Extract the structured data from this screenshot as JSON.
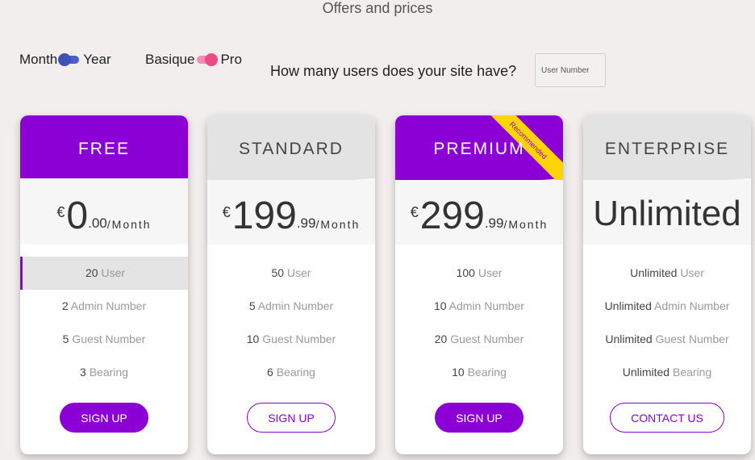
{
  "page_title": "Offers and prices",
  "toggles": {
    "billing_left": "Month",
    "billing_right": "Year",
    "plan_left": "Basique",
    "plan_right": "Pro"
  },
  "users": {
    "question": "How many users does your site have?",
    "placeholder": "User Number"
  },
  "colors": {
    "accent": "#8b00d4",
    "ribbon": "#ffd400",
    "billing_toggle": "#3f51b5",
    "plan_toggle": "#ee4b85"
  },
  "plans": [
    {
      "name": "FREE",
      "currency": "€",
      "price_int": "0",
      "price_dec": ".00",
      "period": "/Month",
      "features": [
        {
          "num": "20",
          "label": "User"
        },
        {
          "num": "2",
          "label": "Admin Number"
        },
        {
          "num": "5",
          "label": "Guest Number"
        },
        {
          "num": "3",
          "label": "Bearing"
        }
      ],
      "button": "SIGN UP"
    },
    {
      "name": "STANDARD",
      "currency": "€",
      "price_int": "199",
      "price_dec": ".99",
      "period": "/Month",
      "features": [
        {
          "num": "50",
          "label": "User"
        },
        {
          "num": "5",
          "label": "Admin Number"
        },
        {
          "num": "10",
          "label": "Guest Number"
        },
        {
          "num": "6",
          "label": "Bearing"
        }
      ],
      "button": "SIGN UP"
    },
    {
      "name": "PREMIUM",
      "ribbon": "Recommended",
      "currency": "€",
      "price_int": "299",
      "price_dec": ".99",
      "period": "/Month",
      "features": [
        {
          "num": "100",
          "label": "User"
        },
        {
          "num": "10",
          "label": "Admin Number"
        },
        {
          "num": "20",
          "label": "Guest Number"
        },
        {
          "num": "10",
          "label": "Bearing"
        }
      ],
      "button": "SIGN UP"
    },
    {
      "name": "ENTERPRISE",
      "price_text": "Unlimited",
      "features": [
        {
          "num": "Unlimited",
          "label": "User"
        },
        {
          "num": "Unlimited",
          "label": "Admin Number"
        },
        {
          "num": "Unlimited",
          "label": "Guest Number"
        },
        {
          "num": "Unlimited",
          "label": "Bearing"
        }
      ],
      "button": "CONTACT US"
    }
  ]
}
